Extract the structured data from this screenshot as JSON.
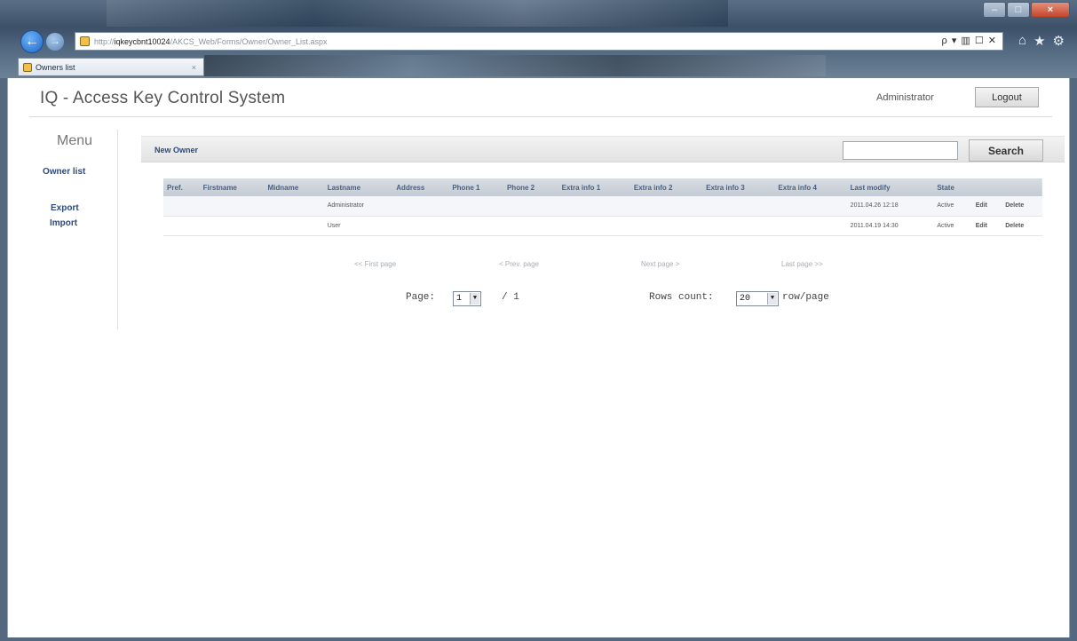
{
  "browser": {
    "url_prefix": "http://",
    "url_host": "iqkeycbnt10024",
    "url_path": "/AKCS_Web/Forms/Owner/Owner_List.aspx",
    "address_tools": "ρ ▾ ▥ ☐ ✕",
    "tab_title": "Owners list",
    "tab_close": "×",
    "back_glyph": "←",
    "forward_glyph": "→",
    "toolbar_icons": [
      "home-icon",
      "favorites-icon",
      "tools-icon"
    ],
    "window_buttons": {
      "minimize": "–",
      "maximize": "□",
      "close": "×"
    }
  },
  "header": {
    "app_title": "IQ - Access Key Control System",
    "user": "Administrator",
    "logout_label": "Logout"
  },
  "menu": {
    "title": "Menu",
    "items": [
      "Owner list",
      "Export",
      "Import"
    ]
  },
  "actions": {
    "new_owner": "New Owner",
    "search_value": "",
    "search_label": "Search"
  },
  "table": {
    "columns": [
      "Pref.",
      "Firstname",
      "Midname",
      "Lastname",
      "Address",
      "Phone 1",
      "Phone 2",
      "Extra info 1",
      "Extra info 2",
      "Extra info 3",
      "Extra info 4",
      "Last modify",
      "State",
      "",
      ""
    ],
    "rows": [
      {
        "pref": "",
        "firstname": "",
        "midname": "",
        "lastname": "Administrator",
        "address": "",
        "phone1": "",
        "phone2": "",
        "extra1": "",
        "extra2": "",
        "extra3": "",
        "extra4": "",
        "last_modify": "2011.04.26 12:18",
        "state": "Active",
        "edit": "Edit",
        "delete": "Delete"
      },
      {
        "pref": "",
        "firstname": "",
        "midname": "",
        "lastname": "User",
        "address": "",
        "phone1": "",
        "phone2": "",
        "extra1": "",
        "extra2": "",
        "extra3": "",
        "extra4": "",
        "last_modify": "2011.04.19 14:30",
        "state": "Active",
        "edit": "Edit",
        "delete": "Delete"
      }
    ]
  },
  "pager": {
    "first": "<< First page",
    "prev": "< Prev. page",
    "next": "Next page >",
    "last": "Last page >>",
    "page_label": "Page:",
    "current_page": "1",
    "total_pages": "/ 1",
    "rows_label": "Rows count:",
    "rows_value": "20",
    "rows_suffix": "row/page"
  },
  "colors": {
    "link": "#2c4a7a",
    "header_bg": "#c5cbd4",
    "disabled": "#a6acb4"
  }
}
